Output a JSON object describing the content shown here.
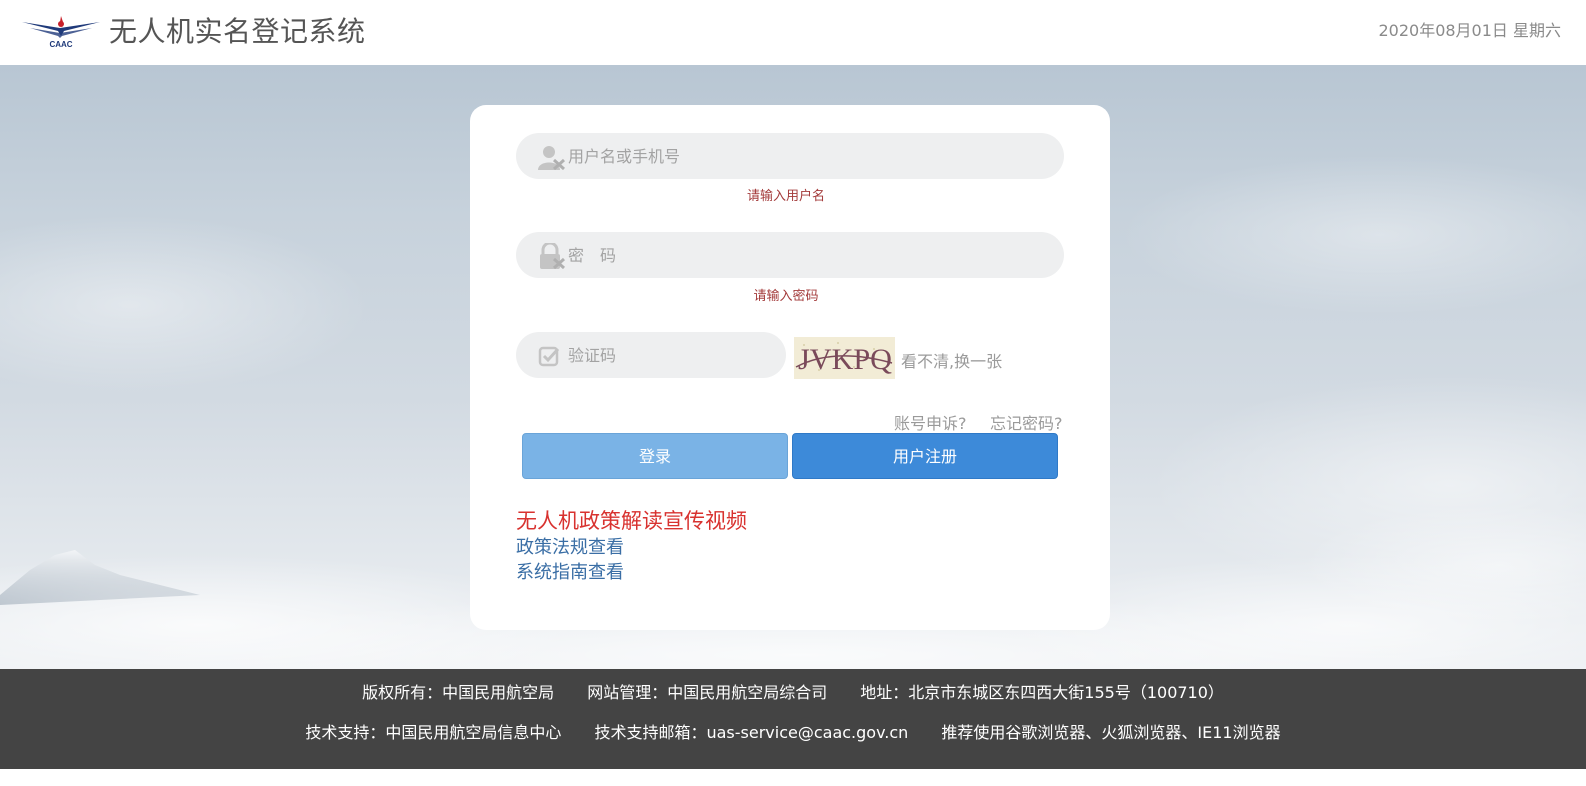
{
  "header": {
    "logo_text": "CAAC",
    "title": "无人机实名登记系统",
    "date": "2020年08月01日 星期六"
  },
  "login": {
    "username_placeholder": "用户名或手机号",
    "username_error": "请输入用户名",
    "password_placeholder": "密　码",
    "password_error": "请输入密码",
    "captcha_placeholder": "验证码",
    "captcha_image_text": "JVKPQ",
    "captcha_refresh": "看不清,换一张",
    "appeal_link": "账号申诉?",
    "forgot_link": "忘记密码?",
    "login_button": "登录",
    "register_button": "用户注册",
    "policy_video_link": "无人机政策解读宣传视频",
    "policy_regulations_link": "政策法规查看",
    "system_guide_link": "系统指南查看"
  },
  "footer": {
    "line1": [
      "版权所有：中国民用航空局",
      "网站管理：中国民用航空局综合司",
      "地址：北京市东城区东四西大街155号（100710）"
    ],
    "line2": [
      "技术支持：中国民用航空局信息中心",
      "技术支持邮箱：uas-service@caac.gov.cn",
      "推荐使用谷歌浏览器、火狐浏览器、IE11浏览器"
    ]
  },
  "colors": {
    "accent_blue": "#3d8ad9",
    "light_blue": "#7ab3e6",
    "error_red": "#a33a3a",
    "video_red": "#d8322f",
    "link_blue": "#3a6ea5",
    "footer_bg": "#444444"
  },
  "icons": {
    "username": "user-icon",
    "password": "lock-icon",
    "captcha": "checkbox-icon"
  }
}
